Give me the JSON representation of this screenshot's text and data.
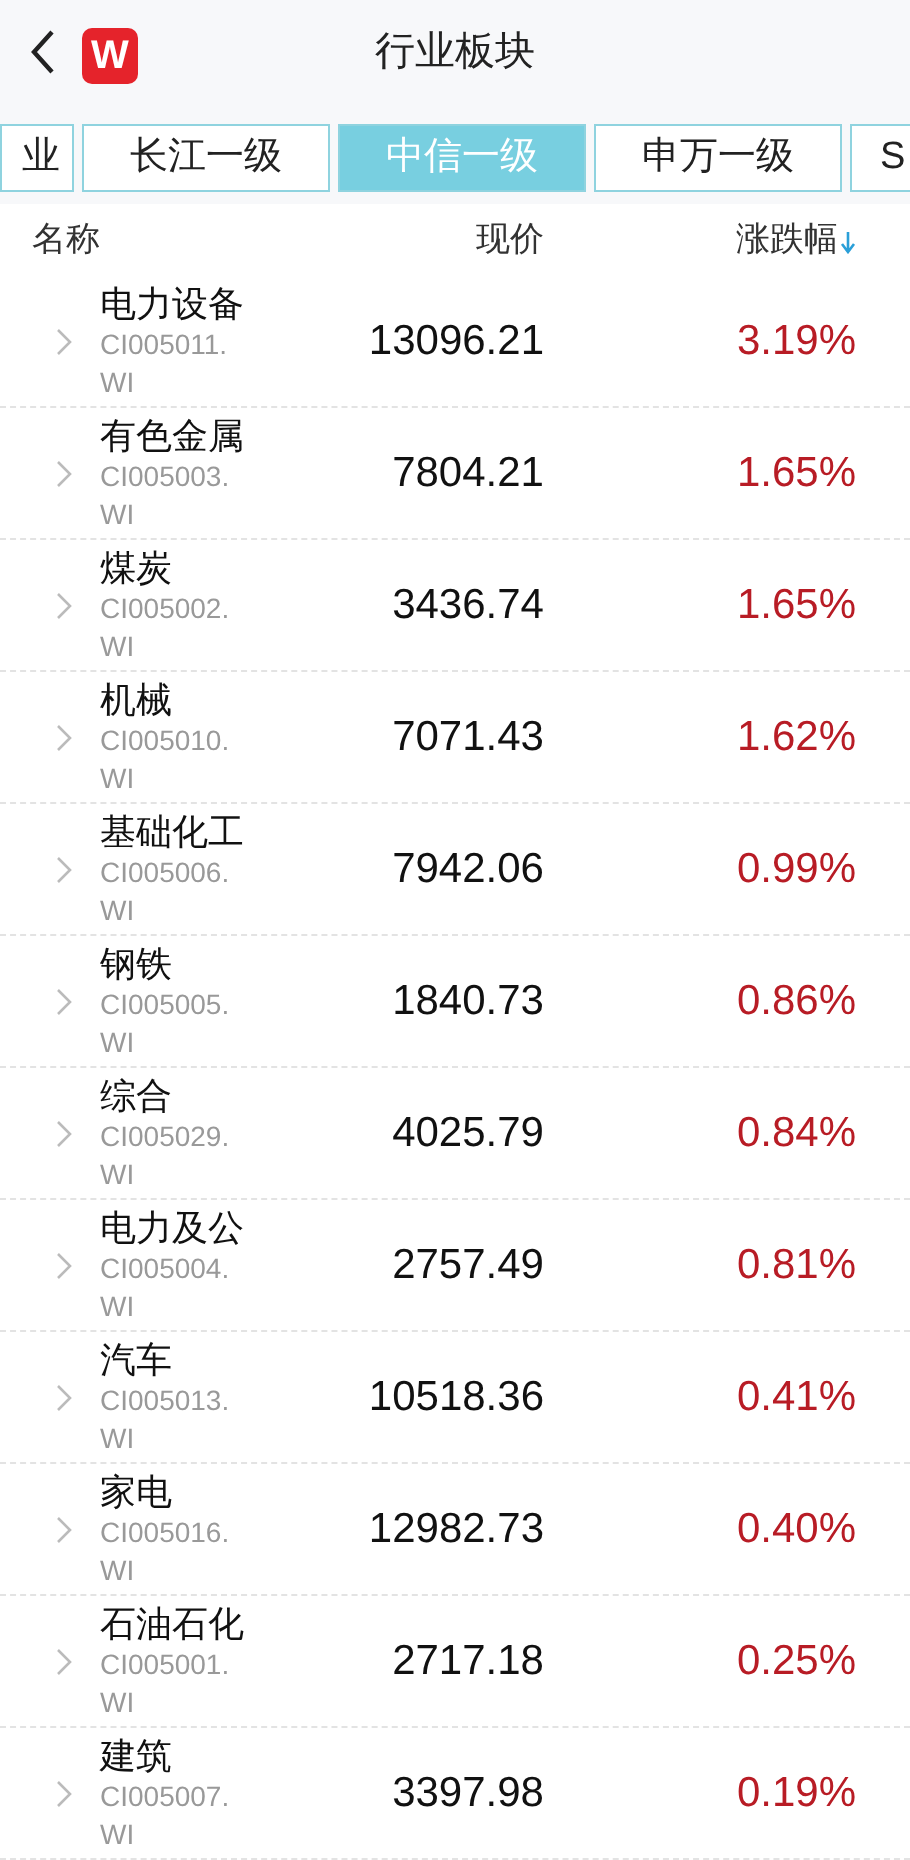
{
  "header": {
    "logo": "W",
    "title": "行业板块"
  },
  "tabs": [
    {
      "label": "业",
      "selected": false,
      "kind": "cut-left"
    },
    {
      "label": "长江一级",
      "selected": false,
      "kind": "full"
    },
    {
      "label": "中信一级",
      "selected": true,
      "kind": "full"
    },
    {
      "label": "申万一级",
      "selected": false,
      "kind": "full"
    },
    {
      "label": "S",
      "selected": false,
      "kind": "cut-right"
    }
  ],
  "table": {
    "columns": [
      {
        "label": "名称",
        "sorted": false
      },
      {
        "label": "现价",
        "sorted": false
      },
      {
        "label": "涨跌幅",
        "sorted": true
      }
    ],
    "rows": [
      {
        "name": "电力设备",
        "code": "CI005011.WI",
        "price": "13096.21",
        "change": "3.19%"
      },
      {
        "name": "有色金属",
        "code": "CI005003.WI",
        "price": "7804.21",
        "change": "1.65%"
      },
      {
        "name": "煤炭",
        "code": "CI005002.WI",
        "price": "3436.74",
        "change": "1.65%"
      },
      {
        "name": "机械",
        "code": "CI005010.WI",
        "price": "7071.43",
        "change": "1.62%"
      },
      {
        "name": "基础化工",
        "code": "CI005006.WI",
        "price": "7942.06",
        "change": "0.99%"
      },
      {
        "name": "钢铁",
        "code": "CI005005.WI",
        "price": "1840.73",
        "change": "0.86%"
      },
      {
        "name": "综合",
        "code": "CI005029.WI",
        "price": "4025.79",
        "change": "0.84%"
      },
      {
        "name": "电力及公",
        "code": "CI005004.WI",
        "price": "2757.49",
        "change": "0.81%"
      },
      {
        "name": "汽车",
        "code": "CI005013.WI",
        "price": "10518.36",
        "change": "0.41%"
      },
      {
        "name": "家电",
        "code": "CI005016.WI",
        "price": "12982.73",
        "change": "0.40%"
      },
      {
        "name": "石油石化",
        "code": "CI005001.WI",
        "price": "2717.18",
        "change": "0.25%"
      },
      {
        "name": "建筑",
        "code": "CI005007.WI",
        "price": "3397.98",
        "change": "0.19%"
      }
    ]
  }
}
